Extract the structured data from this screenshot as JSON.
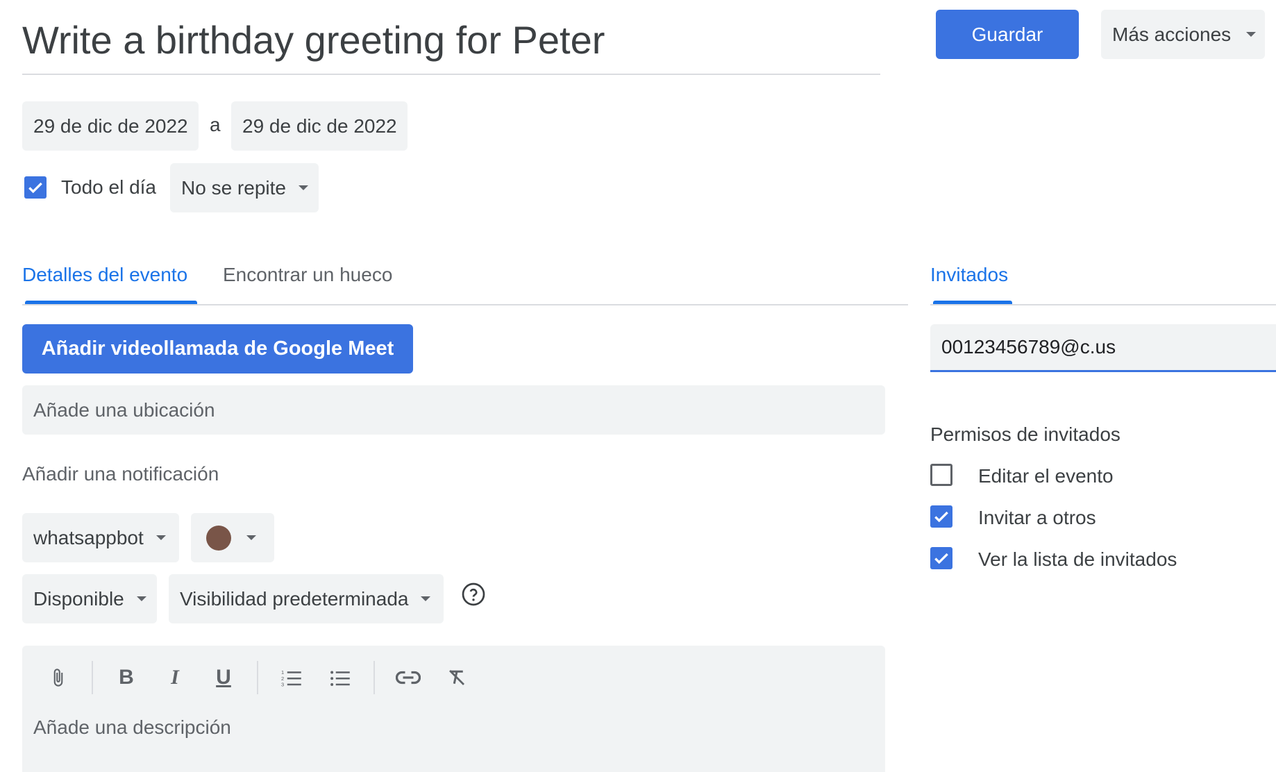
{
  "header": {
    "title": "Write a birthday greeting for Peter",
    "save_label": "Guardar",
    "more_actions_label": "Más acciones"
  },
  "dates": {
    "start": "29 de dic de 2022",
    "separator": "a",
    "end": "29 de dic de 2022"
  },
  "all_day": {
    "label": "Todo el día",
    "checked": true
  },
  "repeat": {
    "selected": "No se repite"
  },
  "tabs": {
    "details": "Detalles del evento",
    "find_slot": "Encontrar un hueco",
    "guests": "Invitados"
  },
  "meet_button": "Añadir videollamada de Google Meet",
  "location_placeholder": "Añade una ubicación",
  "notification_label": "Añadir una notificación",
  "calendar": {
    "selected": "whatsappbot",
    "color": "#795548"
  },
  "availability": {
    "selected": "Disponible"
  },
  "visibility": {
    "selected": "Visibilidad predeterminada"
  },
  "description_placeholder": "Añade una descripción",
  "guests": {
    "input_value": "00123456789@c.us",
    "permissions_title": "Permisos de invitados",
    "permissions": [
      {
        "label": "Editar el evento",
        "checked": false
      },
      {
        "label": "Invitar a otros",
        "checked": true
      },
      {
        "label": "Ver la lista de invitados",
        "checked": true
      }
    ]
  },
  "colors": {
    "accent": "#1a73e8",
    "primary_button": "#3b73e0",
    "field_bg": "#f1f3f4"
  }
}
